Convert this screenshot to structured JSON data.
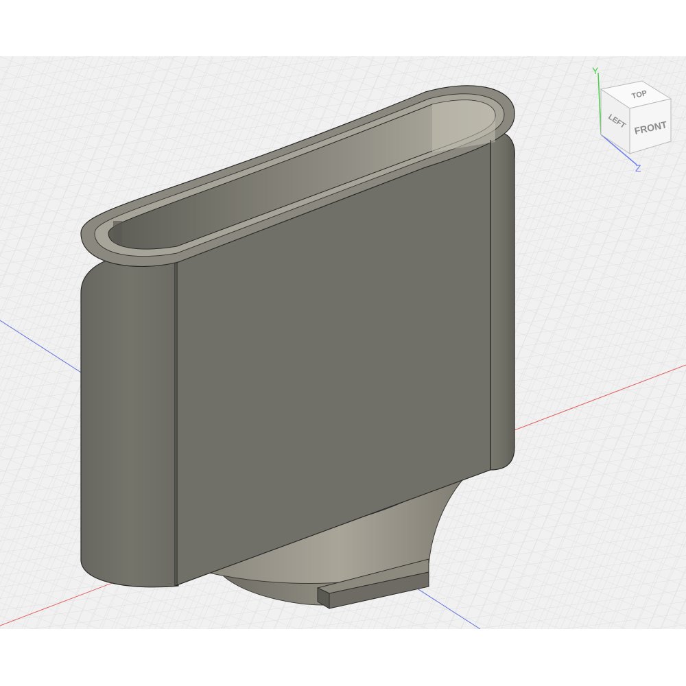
{
  "viewcube": {
    "top_label": "TOP",
    "front_label": "FRONT",
    "left_label": "LEFT",
    "axis_y": "Y",
    "axis_z": "Z"
  },
  "colors": {
    "canvas_bg": "#f1f1f1",
    "grid_minor": "#dedede",
    "grid_major": "#cacaca",
    "axis_x": "#e05555",
    "axis_z": "#5566dd",
    "axis_y": "#4bcc4b",
    "body_front": "#6f6e66",
    "body_side": "#6a695f",
    "body_top": "#7a786e",
    "edge": "#2a2a28"
  },
  "model": {
    "description_shown": "",
    "parts": [
      "oval-holder-body",
      "holder-inner-cavity",
      "flared-neck",
      "round-base",
      "mount-tab"
    ]
  }
}
